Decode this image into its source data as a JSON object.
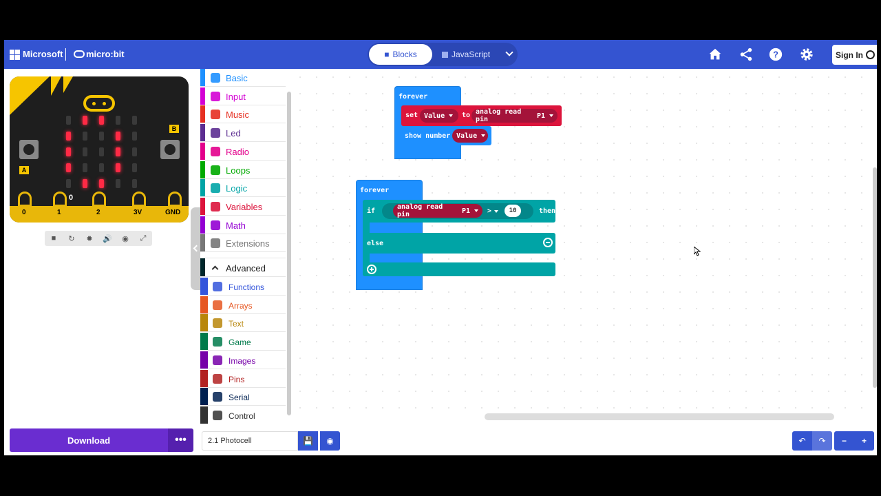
{
  "header": {
    "brand_microsoft": "Microsoft",
    "brand_microbit": "micro:bit",
    "tab_blocks": "Blocks",
    "tab_javascript": "JavaScript",
    "sign_in": "Sign In",
    "icons": [
      "home-icon",
      "share-icon",
      "help-icon",
      "settings-icon"
    ],
    "accent": "#3454D1"
  },
  "simulator": {
    "display_value": "0",
    "buttons": [
      "A",
      "B"
    ],
    "pins": [
      "0",
      "1",
      "2",
      "3V",
      "GND"
    ],
    "led_color": "#ff2a45",
    "controls": [
      "stop-icon",
      "restart-icon",
      "debug-icon",
      "mute-icon",
      "screenshot-icon",
      "fullscreen-icon"
    ]
  },
  "toolbox": {
    "categories": [
      {
        "label": "Basic",
        "color": "#1E90FF"
      },
      {
        "label": "Input",
        "color": "#D400D4"
      },
      {
        "label": "Music",
        "color": "#E63022"
      },
      {
        "label": "Led",
        "color": "#5C2D91"
      },
      {
        "label": "Radio",
        "color": "#E3008C"
      },
      {
        "label": "Loops",
        "color": "#00AA00"
      },
      {
        "label": "Logic",
        "color": "#00A4A6"
      },
      {
        "label": "Variables",
        "color": "#DC143C"
      },
      {
        "label": "Math",
        "color": "#9400D3"
      },
      {
        "label": "Extensions",
        "color": "#777777"
      }
    ],
    "advanced_label": "Advanced",
    "advanced": [
      {
        "label": "Functions",
        "color": "#3455DB"
      },
      {
        "label": "Arrays",
        "color": "#E65722"
      },
      {
        "label": "Text",
        "color": "#B8860B"
      },
      {
        "label": "Game",
        "color": "#007A4B"
      },
      {
        "label": "Images",
        "color": "#7600A8"
      },
      {
        "label": "Pins",
        "color": "#B22222"
      },
      {
        "label": "Serial",
        "color": "#002050"
      },
      {
        "label": "Control",
        "color": "#333333"
      }
    ]
  },
  "workspace": {
    "block1": {
      "hat": "forever",
      "set": "set",
      "var": "Value",
      "to": "to",
      "read": "analog read pin",
      "pin": "P1",
      "show": "show number",
      "show_var": "Value"
    },
    "block2": {
      "hat": "forever",
      "if": "if",
      "read": "analog read pin",
      "pin": "P1",
      "op": ">",
      "num": "10",
      "then": "then",
      "else": "else"
    }
  },
  "footer": {
    "download": "Download",
    "more": "•••",
    "project_name": "2.1 Photocell"
  }
}
